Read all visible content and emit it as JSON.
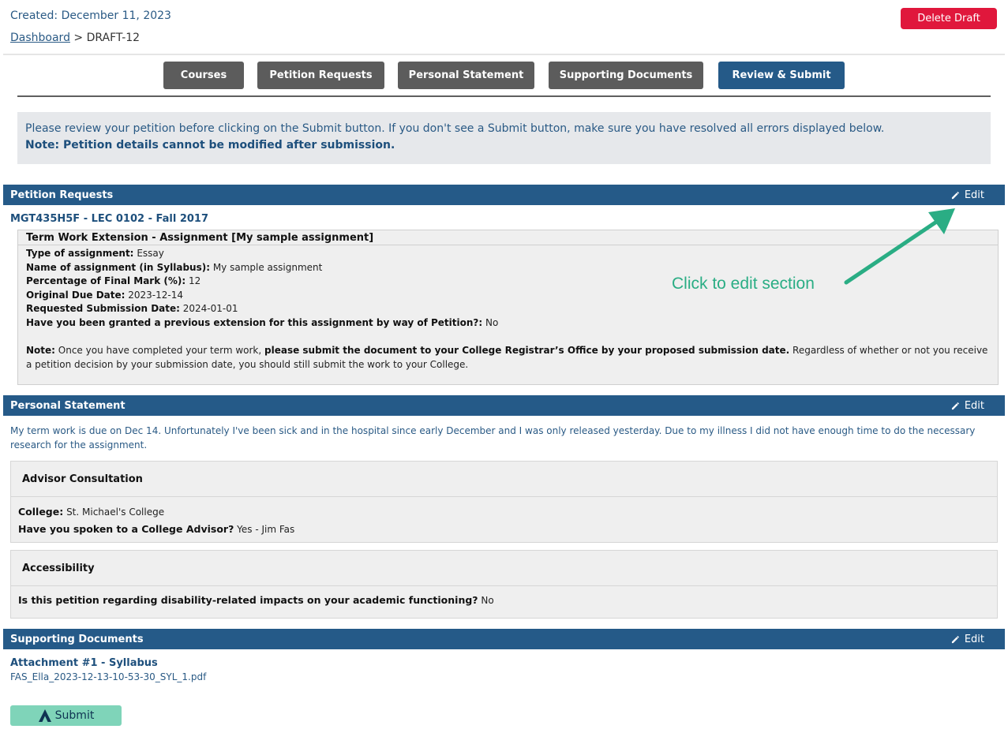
{
  "header": {
    "created": "Created: December 11, 2023",
    "breadcrumb_link": "Dashboard",
    "breadcrumb_sep": ">",
    "breadcrumb_current": "DRAFT-12",
    "delete_label": "Delete Draft"
  },
  "tabs": [
    {
      "label": "Courses"
    },
    {
      "label": "Petition Requests"
    },
    {
      "label": "Personal Statement"
    },
    {
      "label": "Supporting Documents"
    },
    {
      "label": "Review & Submit"
    }
  ],
  "notice": {
    "line1": "Please review your petition before clicking on the Submit button. If you don't see a Submit button, make sure you have resolved all errors displayed below.",
    "line2": "Note: Petition details cannot be modified after submission."
  },
  "petition_requests": {
    "title": "Petition Requests",
    "edit_label": "Edit",
    "course": "MGT435H5F - LEC 0102 - Fall 2017",
    "request_type": "Term Work Extension",
    "request_detail": " - Assignment [My sample assignment]",
    "fields": [
      {
        "label": "Type of assignment:",
        "value": "Essay"
      },
      {
        "label": "Name of assignment (in Syllabus):",
        "value": "My sample assignment"
      },
      {
        "label": "Percentage of Final Mark (%):",
        "value": "12"
      },
      {
        "label": "Original Due Date:",
        "value": "2023-12-14"
      },
      {
        "label": "Requested Submission Date:",
        "value": "2024-01-01"
      },
      {
        "label": "Have you been granted a previous extension for this assignment by way of Petition?:",
        "value": "No"
      }
    ],
    "note_label": "Note:",
    "note_text1": " Once you have completed your term work, ",
    "note_bold": "please submit the document to your College Registrar’s Office by your proposed submission date.",
    "note_text2": " Regardless of whether or not you receive a petition decision by your submission date, you should still submit the work to your College."
  },
  "callout": "Click to edit section",
  "personal_statement": {
    "title": "Personal Statement",
    "edit_label": "Edit",
    "text": "My term work is due on Dec 14. Unfortunately I've been sick and in the hospital since early December and I was only released yesterday. Due to my illness I did not have enough time to do the necessary research for the assignment."
  },
  "advisor": {
    "title": "Advisor Consultation",
    "college_label": "College:",
    "college_value": "St. Michael's College",
    "spoken_label": "Have you spoken to a College Advisor?",
    "spoken_value": "Yes - Jim Fas"
  },
  "accessibility": {
    "title": "Accessibility",
    "question": "Is this petition regarding disability-related impacts on your academic functioning?",
    "answer": "No"
  },
  "supporting_documents": {
    "title": "Supporting Documents",
    "edit_label": "Edit",
    "attachment_title": "Attachment #1 - Syllabus",
    "attachment_file": "FAS_Ella_2023-12-13-10-53-30_SYL_1.pdf"
  },
  "submit_label": "Submit",
  "colors": {
    "primary": "#255a88",
    "tab_inactive": "#5c5c5c",
    "danger": "#e0173c",
    "callout": "#2aad84",
    "submit": "#7fd4b9"
  }
}
